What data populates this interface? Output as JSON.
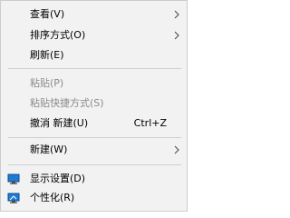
{
  "menu": {
    "items": [
      {
        "label": "查看(V)"
      },
      {
        "label": "排序方式(O)"
      },
      {
        "label": "刷新(E)"
      },
      {
        "label": "粘贴(P)"
      },
      {
        "label": "粘贴快捷方式(S)"
      },
      {
        "label": "撤消 新建(U)",
        "shortcut": "Ctrl+Z"
      },
      {
        "label": "新建(W)"
      },
      {
        "label": "显示设置(D)",
        "icon": "display-settings-icon"
      },
      {
        "label": "个性化(R)",
        "icon": "personalize-icon"
      }
    ]
  },
  "colors": {
    "menu_background": "#f2f2f2",
    "disabled_text": "#8a8a8a",
    "separator": "#cfcfcf"
  }
}
